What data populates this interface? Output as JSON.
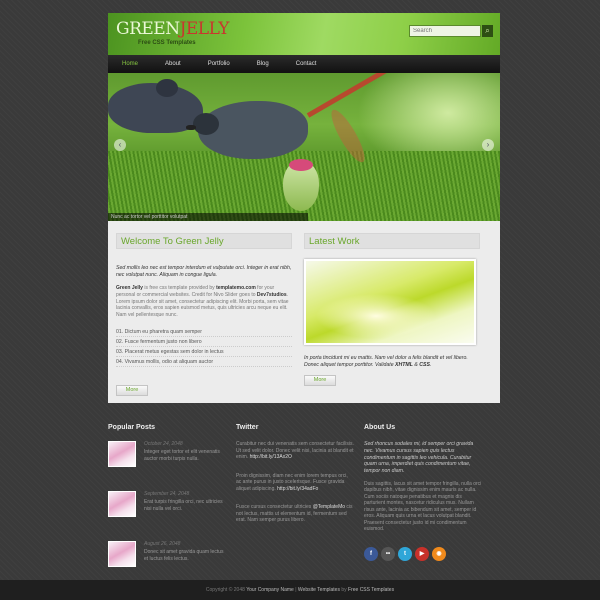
{
  "header": {
    "logo_green": "GREEN",
    "logo_jelly": "JELLY",
    "logo_subtitle": "Free CSS Templates",
    "search_placeholder": "Search"
  },
  "nav": {
    "items": [
      {
        "label": "Home",
        "active": true
      },
      {
        "label": "About"
      },
      {
        "label": "Portfolio"
      },
      {
        "label": "Blog"
      },
      {
        "label": "Contact"
      }
    ]
  },
  "slider": {
    "caption": "Nunc ac tortor vel porttitor volutpat"
  },
  "welcome": {
    "title": "Welcome To Green Jelly",
    "intro": "Sed mollis leo nec est tempor interdum et vulputate orci. Integer in erat nibh, nec volutpat nunc. Aliquam in congue ligula.",
    "para_brand": "Green Jelly",
    "para_1": " is free css template provided by ",
    "para_link": "templatemo.com",
    "para_2": " for your personal or commercial websites. Credit for Nivo Slider goes to ",
    "para_credit": "Dev7studios",
    "para_3": ". Lorem ipsum dolor sit amet, consectetur adipiscing elit. Morbi porta, sem vitae lacinia convallis, eros sapien euismod metus, quis ultricies arcu neque eu elit. Nam vel pellentesque nunc.",
    "list": [
      "01.   Dictum eu pharetra quam semper",
      "02.   Fusce fermentum justo non libero",
      "03.   Placerat metus egestas sem dolor in lectus",
      "04.   Vivamus mollis, odio at aliquam auctor"
    ],
    "more": "More"
  },
  "latest": {
    "title": "Latest Work",
    "text_1": "In porta tincidunt mi eu mattis. Nam vel dolor a felis blandit et vel libero. Donec aliquet tempor porttitor. Validate ",
    "xhtml": "XHTML",
    "amp": " & ",
    "css": "CSS",
    "dot": ".",
    "more": "More"
  },
  "popular": {
    "title": "Popular Posts",
    "posts": [
      {
        "date": "October 24, 2048",
        "text": "Integer eget tortor et elit venenatis auctor morbi turpis nulla."
      },
      {
        "date": "September 24, 2048",
        "text": "Erat turpis fringilla orci, nec ultricies nisi nulla vel orci."
      },
      {
        "date": "August 26, 2048",
        "text": "Donec sit amet gravida quam lectus et luctus felis lectus."
      }
    ]
  },
  "twitter": {
    "title": "Twitter",
    "tweets": [
      {
        "text": "Curabitur nec dui venenatis sem consectetur facilisis. Ut sed velit dolor. Donec velit nisi, lacinia at blandit et enim. ",
        "link": "http://bit.ly/13Ax2O"
      },
      {
        "text": "Proin dignissim, diam nec enim lorem tempus orci, ac ante purus in justo scelerisque. Fusce gravida aliquet adipiscing. ",
        "link": "http://bit.ly/34adFo"
      },
      {
        "text": "Fusce cursus consectetur ultricies ",
        "link": "@TemplateMo",
        "text_2": " cis not lectus, mattis ut elementum id, fermentum sed erat. Nam semper purus libero."
      }
    ]
  },
  "about": {
    "title": "About Us",
    "italic": "Sed rhoncus sodales mi, id semper orci gravida nec. Vivamus cursus sapien quis lectus condimentum in sagittis leo vehicula. Curabitur quam urna, imperdiet quis condimentum vitae, tempor non diam.",
    "para": "Duis sagittis, lacus sit amet tempor fringilla, nulla orci dapibus nibh, vitae dignissim enim mauris ac nulla. Cum sociis natoque penatibus et magnis dis parturient montes, nascetur ridiculus mus. Nullam risus ante, lacinia ac bibendum sit amet, semper id eros. Aliquam quis urna et lacus volutpat blandit. Praesent consectetur justo id mi condimentum euismod.",
    "social": [
      {
        "icon": "facebook-icon",
        "glyph": "f",
        "color": "#3b5998"
      },
      {
        "icon": "flickr-icon",
        "glyph": "••",
        "color": "#555555"
      },
      {
        "icon": "twitter-icon",
        "glyph": "t",
        "color": "#2fa6d8"
      },
      {
        "icon": "youtube-icon",
        "glyph": "▶",
        "color": "#c8312a"
      },
      {
        "icon": "rss-icon",
        "glyph": "◉",
        "color": "#f08a1c"
      }
    ]
  },
  "footer": {
    "copy": "Copyright © 2048 ",
    "company": "Your Company Name",
    "sep": " | ",
    "templates": "Website Templates",
    "by": " by ",
    "free": "Free CSS Templates"
  }
}
